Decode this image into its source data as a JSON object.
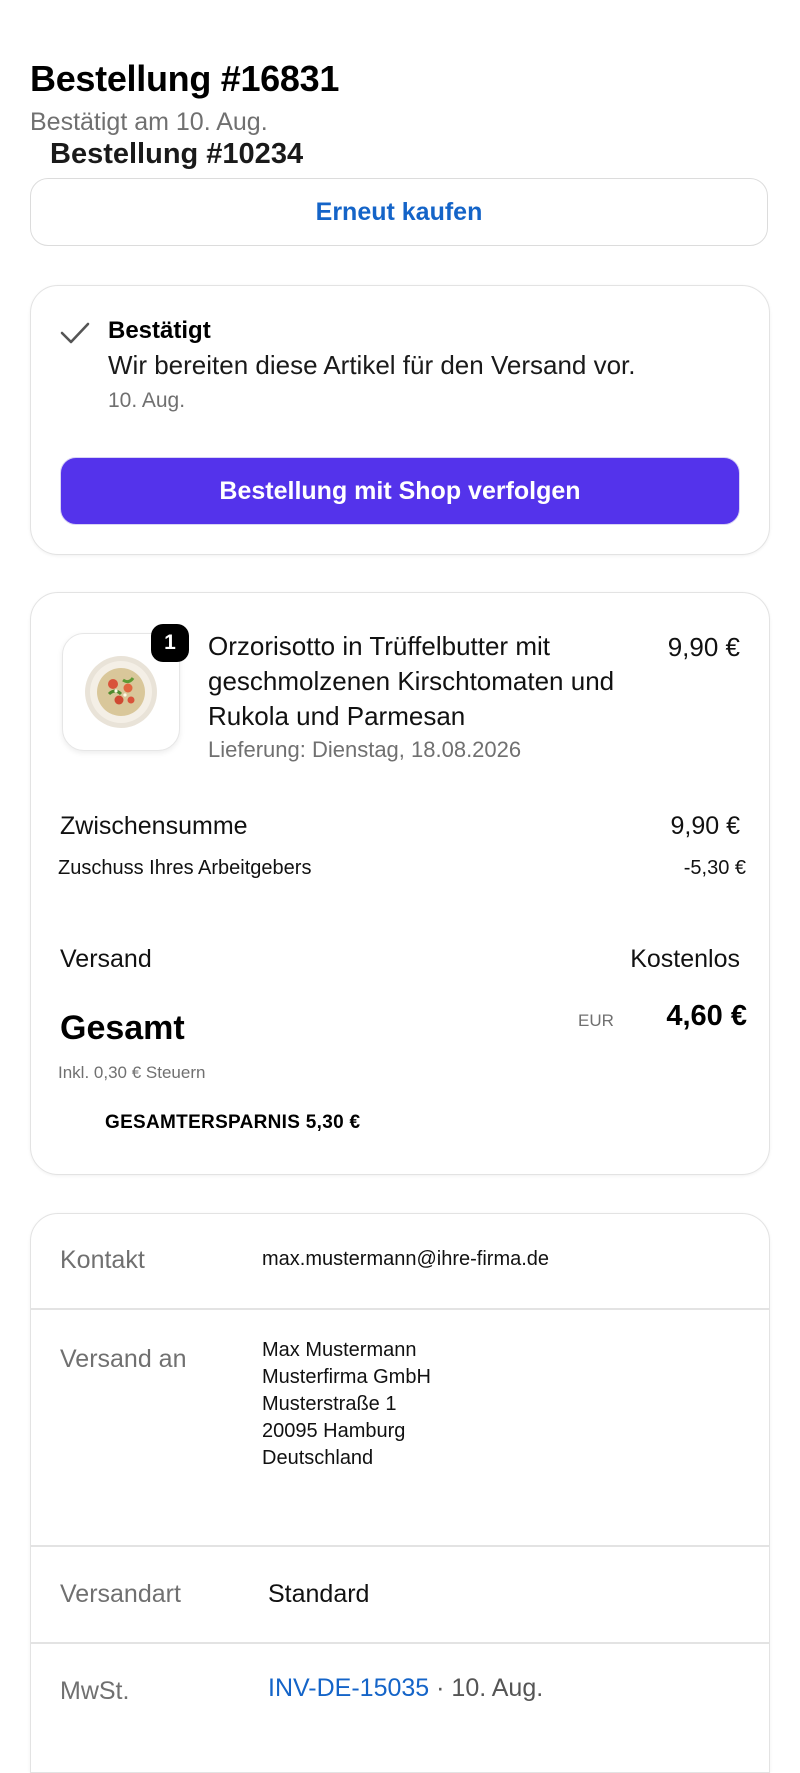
{
  "header": {
    "order_title": "Bestellung #16831",
    "confirmed_subtitle": "Bestätigt am 10. Aug.",
    "overlay_title": "Bestellung #10234",
    "buy_again_label": "Erneut kaufen"
  },
  "status": {
    "icon": "checkmark-icon",
    "title": "Bestätigt",
    "message": "Wir bereiten diese Artikel für den Versand vor.",
    "date": "10. Aug.",
    "track_button_label": "Bestellung mit Shop verfolgen",
    "accent_color": "#5433eb"
  },
  "order": {
    "item": {
      "quantity": "1",
      "name": "Orzorisotto in Trüffelbutter mit geschmolzenen Kirschtomaten und Rukola und Parmesan",
      "price": "9,90 €",
      "delivery": "Lieferung: Dienstag, 18.08.2026"
    },
    "subtotal_label": "Zwischensumme",
    "subtotal_value": "9,90 €",
    "subsidy_label": "Zuschuss Ihres Arbeitgebers",
    "subsidy_value": "-5,30 €",
    "shipping_label": "Versand",
    "shipping_value": "Kostenlos",
    "total_label": "Gesamt",
    "total_currency": "EUR",
    "total_value": "4,60 €",
    "tax_note": "Inkl. 0,30 € Steuern",
    "savings": "GESAMTERSPARNIS 5,30 €"
  },
  "details": {
    "contact_label": "Kontakt",
    "contact_value": "max.mustermann@ihre-firma.de",
    "ship_to_label": "Versand an",
    "address": [
      "Max Mustermann",
      "Musterfirma GmbH",
      "Musterstraße 1",
      "20095 Hamburg",
      "Deutschland"
    ],
    "shipping_method_label": "Versandart",
    "shipping_method_value": "Standard",
    "vat_label": "MwSt.",
    "invoice_number": "INV-DE-15035",
    "invoice_date": " · 10. Aug."
  },
  "colors": {
    "link": "#1464c8",
    "primary_button": "#5433eb",
    "muted_text": "#707070",
    "border": "#e3e3e3"
  }
}
